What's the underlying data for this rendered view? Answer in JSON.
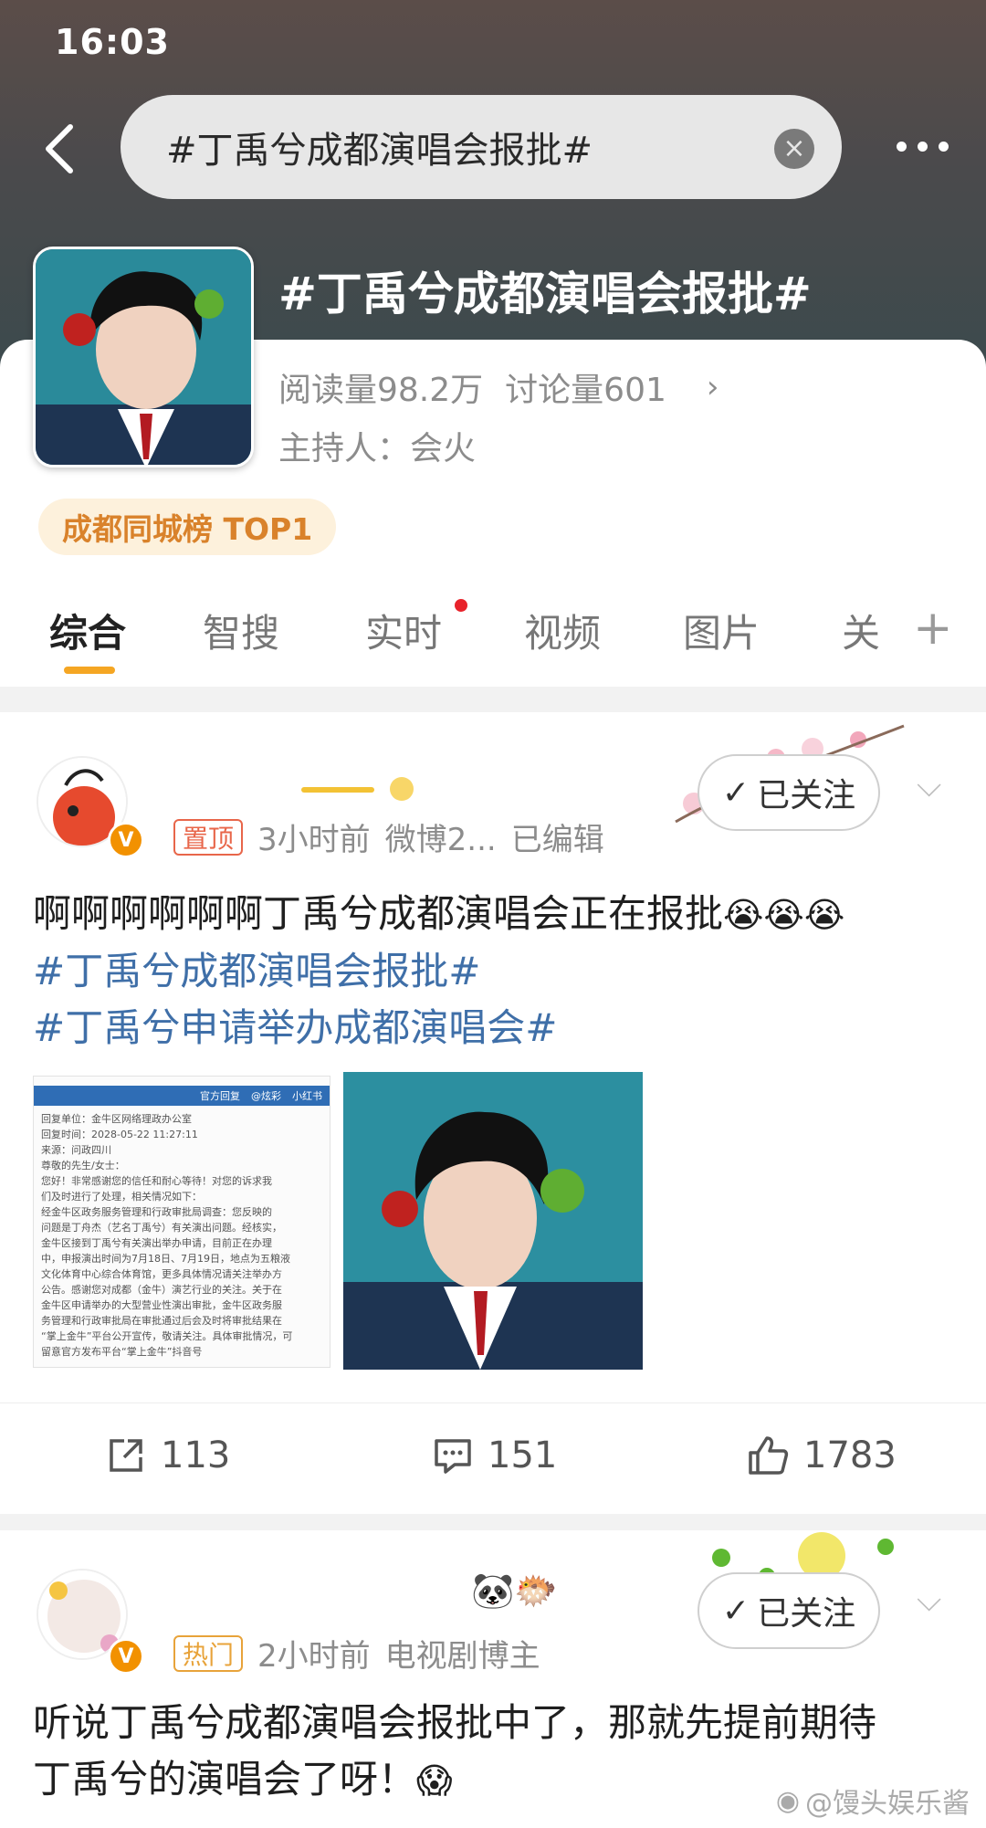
{
  "status_bar": {
    "time": "16:03"
  },
  "search": {
    "query": "#丁禹兮成都演唱会报批#"
  },
  "topic": {
    "title": "#丁禹兮成都演唱会报批#",
    "reads": "阅读量98.2万",
    "discussions": "讨论量601",
    "host_label": "主持人：会火",
    "rank": "成都同城榜 TOP1"
  },
  "tabs": [
    {
      "label": "综合"
    },
    {
      "label": "智搜"
    },
    {
      "label": "实时"
    },
    {
      "label": "视频"
    },
    {
      "label": "图片"
    },
    {
      "label": "关"
    }
  ],
  "post1": {
    "tag": "置顶",
    "time": "3小时前",
    "source": "微博2...",
    "edited": "已编辑",
    "follow_label": "已关注",
    "text": "啊啊啊啊啊啊丁禹兮成都演唱会正在报批",
    "emojis": "😭😭😭",
    "hashtag1": "#丁禹兮成都演唱会报批#",
    "hashtag2": "#丁禹兮申请举办成都演唱会#",
    "doc": {
      "bar_items": [
        "官方回复",
        "@炫彩",
        "小红书"
      ],
      "lines": [
        "回复单位：金牛区网络理政办公室",
        "回复时间：2028-05-22 11:27:11",
        "来源：问政四川",
        "尊敬的先生/女士：",
        "您好！非常感谢您的信任和耐心等待！对您的诉求我",
        "们及时进行了处理，相关情况如下：",
        "经金牛区政务服务管理和行政审批局调查：您反映的",
        "问题是丁舟杰（艺名丁禹兮）有关演出问题。经核实，",
        "金牛区接到丁禹兮有关演出举办申请，目前正在办理",
        "中，申报演出时间为7月18日、7月19日，地点为五粮液",
        "文化体育中心综合体育馆，更多具体情况请关注举办方",
        "公告。感谢您对成都（金牛）演艺行业的关注。关于在",
        "金牛区申请举办的大型营业性演出审批，金牛区政务服",
        "务管理和行政审批局在审批通过后会及时将审批结果在",
        "“掌上金牛”平台公开宣传，敬请关注。具体审批情况，可",
        "留意官方发布平台“掌上金牛”抖音号"
      ]
    },
    "reposts": "113",
    "comments": "151",
    "likes": "1783"
  },
  "post2": {
    "tag": "热门",
    "time": "2小时前",
    "source": "电视剧博主",
    "follow_label": "已关注",
    "name_emojis": "🐼🐡",
    "text_line1": "听说丁禹兮成都演唱会报批中了，那就先提前期待",
    "text_line2": "丁禹兮的演唱会了呀！",
    "emoji": "😱"
  },
  "watermark": {
    "text": "@馒头娱乐酱"
  },
  "colors": {
    "accent": "#f5a623",
    "hashtag": "#3f6fa8",
    "vip": "#f29100"
  }
}
